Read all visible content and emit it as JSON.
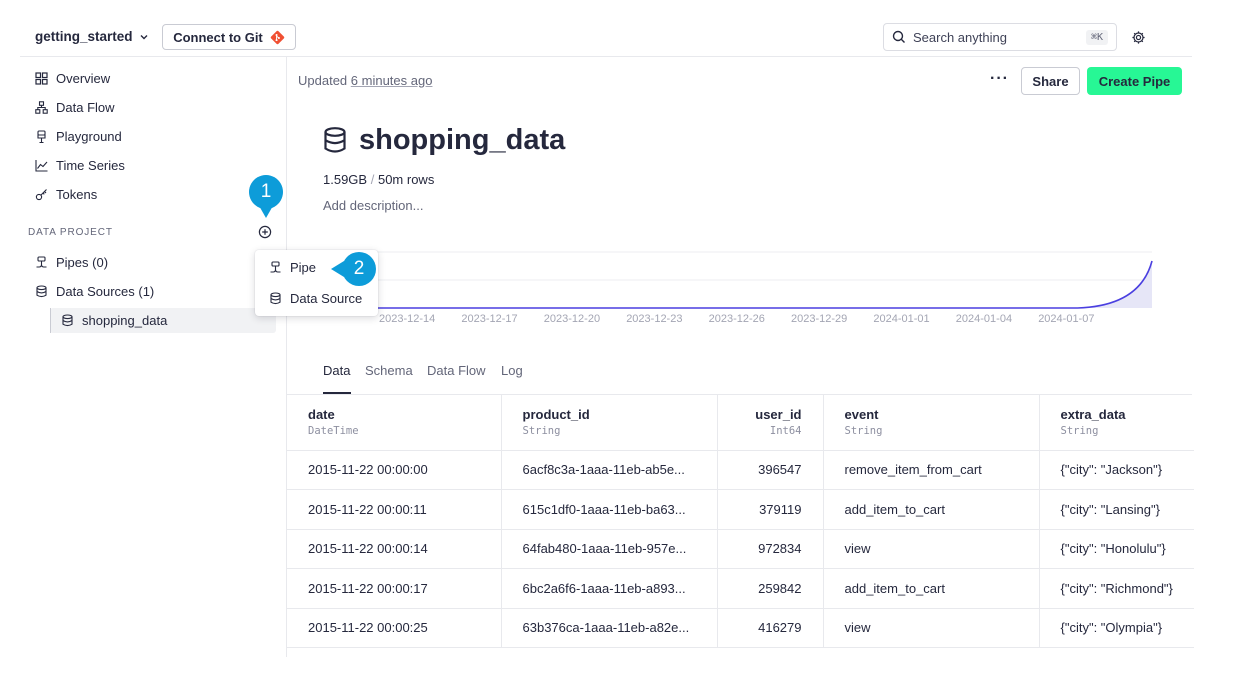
{
  "header": {
    "project_name": "getting_started",
    "git_button": "Connect to Git",
    "search_placeholder": "Search anything",
    "search_shortcut": "⌘K"
  },
  "sidebar": {
    "nav": [
      {
        "label": "Overview",
        "icon": "grid-icon"
      },
      {
        "label": "Data Flow",
        "icon": "flow-icon"
      },
      {
        "label": "Playground",
        "icon": "playground-icon"
      },
      {
        "label": "Time Series",
        "icon": "chart-line-icon"
      },
      {
        "label": "Tokens",
        "icon": "key-icon"
      }
    ],
    "section_title": "DATA PROJECT",
    "pipes_label": "Pipes (0)",
    "datasources_label": "Data Sources (1)",
    "selected_datasource": "shopping_data"
  },
  "badges": {
    "one": "1",
    "two": "2"
  },
  "add_menu": {
    "items": [
      "Pipe",
      "Data Source"
    ]
  },
  "main": {
    "updated_prefix": "Updated",
    "updated_time": "6 minutes ago",
    "share_label": "Share",
    "create_pipe_label": "Create Pipe",
    "title": "shopping_data",
    "size": "1.59GB",
    "rows": "50m rows",
    "meta_separator": "/",
    "description_placeholder": "Add description...",
    "tabs": [
      "Data",
      "Schema",
      "Data Flow",
      "Log"
    ],
    "active_tab": "Data"
  },
  "chart_data": {
    "type": "area",
    "x": [
      "2023-12-14",
      "2023-12-17",
      "2023-12-20",
      "2023-12-23",
      "2023-12-26",
      "2023-12-29",
      "2024-01-01",
      "2024-01-04",
      "2024-01-07"
    ],
    "series": [
      {
        "values": [
          0,
          0,
          0,
          0,
          0,
          0,
          0,
          0,
          0
        ]
      }
    ],
    "note": "Near-zero throughout with a sharp spike at the last date after 2024-01-07",
    "line_color": "#4a3fe0",
    "fill_color": "#e6e6f7"
  },
  "table": {
    "columns": [
      {
        "name": "date",
        "type": "DateTime"
      },
      {
        "name": "product_id",
        "type": "String"
      },
      {
        "name": "user_id",
        "type": "Int64"
      },
      {
        "name": "event",
        "type": "String"
      },
      {
        "name": "extra_data",
        "type": "String"
      }
    ],
    "rows": [
      [
        "2015-11-22 00:00:00",
        "6acf8c3a-1aaa-11eb-ab5e...",
        "396547",
        "remove_item_from_cart",
        "{\"city\": \"Jackson\"}"
      ],
      [
        "2015-11-22 00:00:11",
        "615c1df0-1aaa-11eb-ba63...",
        "379119",
        "add_item_to_cart",
        "{\"city\": \"Lansing\"}"
      ],
      [
        "2015-11-22 00:00:14",
        "64fab480-1aaa-11eb-957e...",
        "972834",
        "view",
        "{\"city\": \"Honolulu\"}"
      ],
      [
        "2015-11-22 00:00:17",
        "6bc2a6f6-1aaa-11eb-a893...",
        "259842",
        "add_item_to_cart",
        "{\"city\": \"Richmond\"}"
      ],
      [
        "2015-11-22 00:00:25",
        "63b376ca-1aaa-11eb-a82e...",
        "416279",
        "view",
        "{\"city\": \"Olympia\"}"
      ]
    ]
  }
}
